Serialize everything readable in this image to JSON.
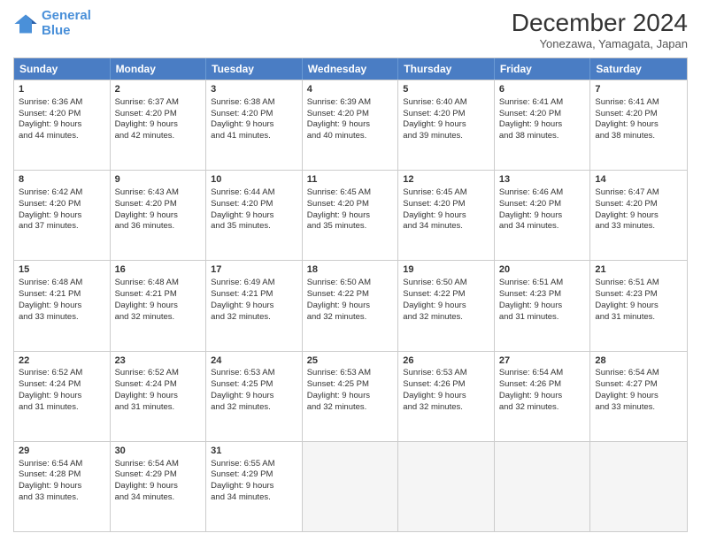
{
  "header": {
    "logo_line1": "General",
    "logo_line2": "Blue",
    "main_title": "December 2024",
    "subtitle": "Yonezawa, Yamagata, Japan"
  },
  "calendar": {
    "days_of_week": [
      "Sunday",
      "Monday",
      "Tuesday",
      "Wednesday",
      "Thursday",
      "Friday",
      "Saturday"
    ],
    "rows": [
      [
        {
          "day": "1",
          "lines": [
            "Sunrise: 6:36 AM",
            "Sunset: 4:20 PM",
            "Daylight: 9 hours",
            "and 44 minutes."
          ]
        },
        {
          "day": "2",
          "lines": [
            "Sunrise: 6:37 AM",
            "Sunset: 4:20 PM",
            "Daylight: 9 hours",
            "and 42 minutes."
          ]
        },
        {
          "day": "3",
          "lines": [
            "Sunrise: 6:38 AM",
            "Sunset: 4:20 PM",
            "Daylight: 9 hours",
            "and 41 minutes."
          ]
        },
        {
          "day": "4",
          "lines": [
            "Sunrise: 6:39 AM",
            "Sunset: 4:20 PM",
            "Daylight: 9 hours",
            "and 40 minutes."
          ]
        },
        {
          "day": "5",
          "lines": [
            "Sunrise: 6:40 AM",
            "Sunset: 4:20 PM",
            "Daylight: 9 hours",
            "and 39 minutes."
          ]
        },
        {
          "day": "6",
          "lines": [
            "Sunrise: 6:41 AM",
            "Sunset: 4:20 PM",
            "Daylight: 9 hours",
            "and 38 minutes."
          ]
        },
        {
          "day": "7",
          "lines": [
            "Sunrise: 6:41 AM",
            "Sunset: 4:20 PM",
            "Daylight: 9 hours",
            "and 38 minutes."
          ]
        }
      ],
      [
        {
          "day": "8",
          "lines": [
            "Sunrise: 6:42 AM",
            "Sunset: 4:20 PM",
            "Daylight: 9 hours",
            "and 37 minutes."
          ]
        },
        {
          "day": "9",
          "lines": [
            "Sunrise: 6:43 AM",
            "Sunset: 4:20 PM",
            "Daylight: 9 hours",
            "and 36 minutes."
          ]
        },
        {
          "day": "10",
          "lines": [
            "Sunrise: 6:44 AM",
            "Sunset: 4:20 PM",
            "Daylight: 9 hours",
            "and 35 minutes."
          ]
        },
        {
          "day": "11",
          "lines": [
            "Sunrise: 6:45 AM",
            "Sunset: 4:20 PM",
            "Daylight: 9 hours",
            "and 35 minutes."
          ]
        },
        {
          "day": "12",
          "lines": [
            "Sunrise: 6:45 AM",
            "Sunset: 4:20 PM",
            "Daylight: 9 hours",
            "and 34 minutes."
          ]
        },
        {
          "day": "13",
          "lines": [
            "Sunrise: 6:46 AM",
            "Sunset: 4:20 PM",
            "Daylight: 9 hours",
            "and 34 minutes."
          ]
        },
        {
          "day": "14",
          "lines": [
            "Sunrise: 6:47 AM",
            "Sunset: 4:20 PM",
            "Daylight: 9 hours",
            "and 33 minutes."
          ]
        }
      ],
      [
        {
          "day": "15",
          "lines": [
            "Sunrise: 6:48 AM",
            "Sunset: 4:21 PM",
            "Daylight: 9 hours",
            "and 33 minutes."
          ]
        },
        {
          "day": "16",
          "lines": [
            "Sunrise: 6:48 AM",
            "Sunset: 4:21 PM",
            "Daylight: 9 hours",
            "and 32 minutes."
          ]
        },
        {
          "day": "17",
          "lines": [
            "Sunrise: 6:49 AM",
            "Sunset: 4:21 PM",
            "Daylight: 9 hours",
            "and 32 minutes."
          ]
        },
        {
          "day": "18",
          "lines": [
            "Sunrise: 6:50 AM",
            "Sunset: 4:22 PM",
            "Daylight: 9 hours",
            "and 32 minutes."
          ]
        },
        {
          "day": "19",
          "lines": [
            "Sunrise: 6:50 AM",
            "Sunset: 4:22 PM",
            "Daylight: 9 hours",
            "and 32 minutes."
          ]
        },
        {
          "day": "20",
          "lines": [
            "Sunrise: 6:51 AM",
            "Sunset: 4:23 PM",
            "Daylight: 9 hours",
            "and 31 minutes."
          ]
        },
        {
          "day": "21",
          "lines": [
            "Sunrise: 6:51 AM",
            "Sunset: 4:23 PM",
            "Daylight: 9 hours",
            "and 31 minutes."
          ]
        }
      ],
      [
        {
          "day": "22",
          "lines": [
            "Sunrise: 6:52 AM",
            "Sunset: 4:24 PM",
            "Daylight: 9 hours",
            "and 31 minutes."
          ]
        },
        {
          "day": "23",
          "lines": [
            "Sunrise: 6:52 AM",
            "Sunset: 4:24 PM",
            "Daylight: 9 hours",
            "and 31 minutes."
          ]
        },
        {
          "day": "24",
          "lines": [
            "Sunrise: 6:53 AM",
            "Sunset: 4:25 PM",
            "Daylight: 9 hours",
            "and 32 minutes."
          ]
        },
        {
          "day": "25",
          "lines": [
            "Sunrise: 6:53 AM",
            "Sunset: 4:25 PM",
            "Daylight: 9 hours",
            "and 32 minutes."
          ]
        },
        {
          "day": "26",
          "lines": [
            "Sunrise: 6:53 AM",
            "Sunset: 4:26 PM",
            "Daylight: 9 hours",
            "and 32 minutes."
          ]
        },
        {
          "day": "27",
          "lines": [
            "Sunrise: 6:54 AM",
            "Sunset: 4:26 PM",
            "Daylight: 9 hours",
            "and 32 minutes."
          ]
        },
        {
          "day": "28",
          "lines": [
            "Sunrise: 6:54 AM",
            "Sunset: 4:27 PM",
            "Daylight: 9 hours",
            "and 33 minutes."
          ]
        }
      ],
      [
        {
          "day": "29",
          "lines": [
            "Sunrise: 6:54 AM",
            "Sunset: 4:28 PM",
            "Daylight: 9 hours",
            "and 33 minutes."
          ]
        },
        {
          "day": "30",
          "lines": [
            "Sunrise: 6:54 AM",
            "Sunset: 4:29 PM",
            "Daylight: 9 hours",
            "and 34 minutes."
          ]
        },
        {
          "day": "31",
          "lines": [
            "Sunrise: 6:55 AM",
            "Sunset: 4:29 PM",
            "Daylight: 9 hours",
            "and 34 minutes."
          ]
        },
        {
          "day": "",
          "lines": []
        },
        {
          "day": "",
          "lines": []
        },
        {
          "day": "",
          "lines": []
        },
        {
          "day": "",
          "lines": []
        }
      ]
    ]
  }
}
